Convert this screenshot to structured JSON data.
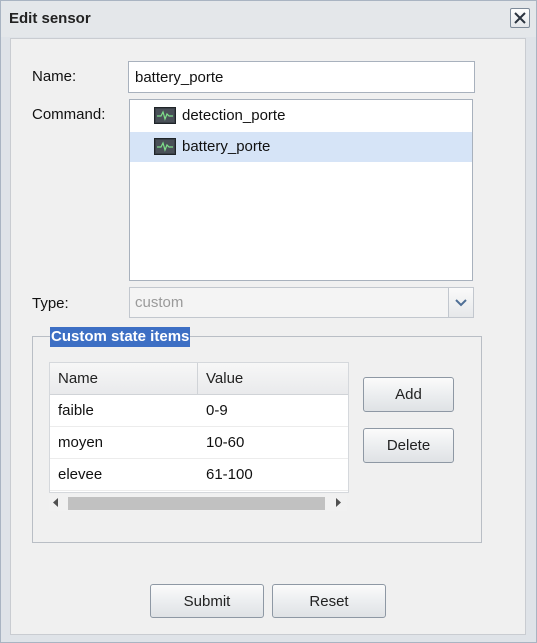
{
  "window": {
    "title": "Edit sensor"
  },
  "form": {
    "name_label": "Name:",
    "name_value": "battery_porte",
    "command_label": "Command:",
    "commands": [
      {
        "label": "detection_porte",
        "selected": false
      },
      {
        "label": "battery_porte",
        "selected": true
      }
    ],
    "type_label": "Type:",
    "type_value": "custom"
  },
  "custom_state": {
    "legend": "Custom state items",
    "columns": [
      "Name",
      "Value"
    ],
    "rows": [
      {
        "name": "faible",
        "value": "0-9"
      },
      {
        "name": "moyen",
        "value": "10-60"
      },
      {
        "name": "elevee",
        "value": "61-100"
      }
    ],
    "add_label": "Add",
    "delete_label": "Delete"
  },
  "footer": {
    "submit_label": "Submit",
    "reset_label": "Reset"
  },
  "colors": {
    "selection": "#d6e4f7",
    "legend_bg": "#3d6fc4"
  }
}
